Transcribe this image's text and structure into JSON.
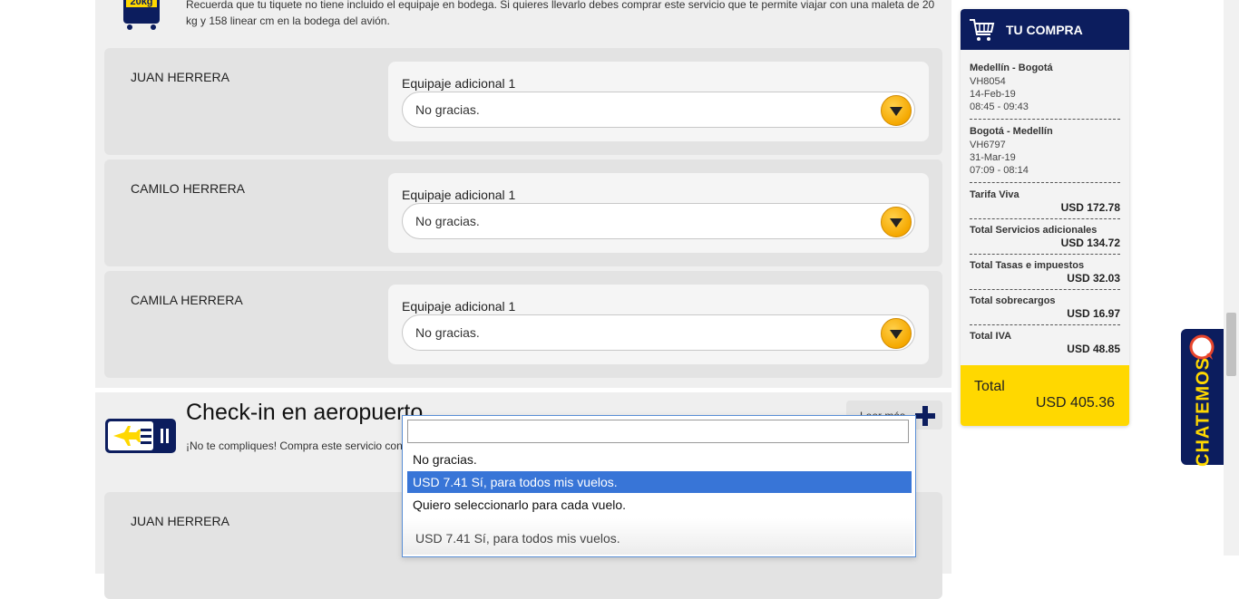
{
  "baggage": {
    "description": "Recuerda que tu tiquete no tiene incluido el equipaje en bodega. Si quieres llevarlo debes comprar este servicio que te permite viajar con una maleta de 20 kg y 158 linear cm en la bodega del avión.",
    "icon": "suitcase-20kg-icon",
    "icon_text": "20kg",
    "passengers": [
      {
        "name": "JUAN HERRERA",
        "field_label": "Equipaje adicional 1",
        "selected": "No gracias."
      },
      {
        "name": "CAMILO HERRERA",
        "field_label": "Equipaje adicional 1",
        "selected": "No gracias."
      },
      {
        "name": "CAMILA HERRERA",
        "field_label": "Equipaje adicional 1",
        "selected": "No gracias."
      }
    ]
  },
  "checkin": {
    "title": "Check-in en aeropuerto",
    "description": "¡No te compliques! Compra este servicio con anticipación y realiza el check-in en el aeropuerto hasta 1 hora antes de tu vuelo.",
    "read_more": "Leer más",
    "passengers": [
      {
        "name": "JUAN HERRERA"
      }
    ]
  },
  "dropdown": {
    "search_value": "",
    "options": [
      "No gracias.",
      "USD 7.41 Sí, para todos mis vuelos.",
      "Quiero seleccionarlo para cada vuelo."
    ],
    "highlighted_index": 1,
    "current_value": "USD 7.41 Sí, para todos mis vuelos."
  },
  "cart": {
    "title": "TU COMPRA",
    "flights": [
      {
        "route": "Medellín - Bogotá",
        "code": "VH8054",
        "date": "14-Feb-19",
        "time": "08:45 - 09:43"
      },
      {
        "route": "Bogotá - Medellín",
        "code": "VH6797",
        "date": "31-Mar-19",
        "time": "07:09 - 08:14"
      }
    ],
    "items": [
      {
        "label": "Tarifa Viva",
        "amount": "USD 172.78"
      },
      {
        "label": "Total Servicios adicionales",
        "amount": "USD 134.72"
      },
      {
        "label": "Total Tasas e impuestos",
        "amount": "USD 32.03"
      },
      {
        "label": "Total sobrecargos",
        "amount": "USD 16.97"
      },
      {
        "label": "Total IVA",
        "amount": "USD 48.85"
      }
    ],
    "total_label": "Total",
    "total_value": "USD 405.36"
  },
  "chat": {
    "label": "CHATEMOS"
  },
  "colors": {
    "brand_navy": "#0c1d5e",
    "brand_yellow": "#ffd800",
    "select_highlight": "#3875d7"
  }
}
